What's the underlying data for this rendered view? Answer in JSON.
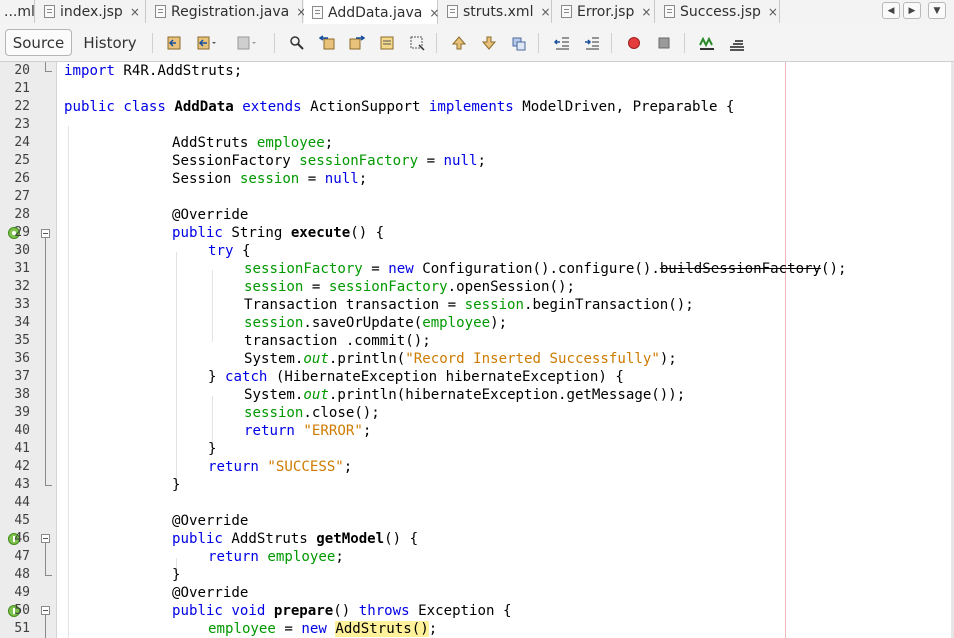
{
  "tabs": [
    {
      "label": "...ml",
      "icon": "file-icon",
      "active": false,
      "closable": false
    },
    {
      "label": "index.jsp",
      "icon": "jsp-file-icon",
      "active": false,
      "closable": true
    },
    {
      "label": "Registration.java",
      "icon": "java-file-icon",
      "active": false,
      "closable": true
    },
    {
      "label": "AddData.java",
      "icon": "java-file-icon",
      "active": true,
      "closable": true
    },
    {
      "label": "struts.xml",
      "icon": "xml-file-icon",
      "active": false,
      "closable": true
    },
    {
      "label": "Error.jsp",
      "icon": "jsp-file-icon",
      "active": false,
      "closable": true
    },
    {
      "label": "Success.jsp",
      "icon": "jsp-file-icon",
      "active": false,
      "closable": true
    }
  ],
  "tab_close_glyph": "×",
  "nav": {
    "left": "◀",
    "right": "▶",
    "dropdown": "▼"
  },
  "toolbar": {
    "source_label": "Source",
    "history_label": "History"
  },
  "editor": {
    "margin_color": "#f2b8b8",
    "lines": [
      {
        "n": "20",
        "segs": [
          {
            "t": "import",
            "c": "kw"
          },
          {
            "t": " R4R.AddStruts;"
          }
        ]
      },
      {
        "n": "21",
        "segs": []
      },
      {
        "n": "22",
        "segs": [
          {
            "t": "public class",
            "c": "kw"
          },
          {
            "t": " "
          },
          {
            "t": "AddData",
            "c": "bold"
          },
          {
            "t": " "
          },
          {
            "t": "extends",
            "c": "kw"
          },
          {
            "t": " ActionSupport "
          },
          {
            "t": "implements",
            "c": "kw"
          },
          {
            "t": " ModelDriven, Preparable {"
          }
        ]
      },
      {
        "n": "23",
        "segs": []
      },
      {
        "n": "24",
        "segs": [
          {
            "t": "AddStruts "
          },
          {
            "t": "employee",
            "c": "fld"
          },
          {
            "t": ";"
          }
        ]
      },
      {
        "n": "25",
        "segs": [
          {
            "t": "SessionFactory "
          },
          {
            "t": "sessionFactory",
            "c": "fld"
          },
          {
            "t": " = "
          },
          {
            "t": "null",
            "c": "kw"
          },
          {
            "t": ";"
          }
        ]
      },
      {
        "n": "26",
        "segs": [
          {
            "t": "Session "
          },
          {
            "t": "session",
            "c": "fld"
          },
          {
            "t": " = "
          },
          {
            "t": "null",
            "c": "kw"
          },
          {
            "t": ";"
          }
        ]
      },
      {
        "n": "27",
        "segs": []
      },
      {
        "n": "28",
        "segs": [
          {
            "t": "@Override"
          }
        ]
      },
      {
        "n": "29",
        "segs": [
          {
            "t": "public",
            "c": "kw"
          },
          {
            "t": " String "
          },
          {
            "t": "execute",
            "c": "bold"
          },
          {
            "t": "() {"
          }
        ]
      },
      {
        "n": "30",
        "segs": [
          {
            "t": "try",
            "c": "kw"
          },
          {
            "t": " {"
          }
        ]
      },
      {
        "n": "31",
        "segs": [
          {
            "t": "sessionFactory",
            "c": "fld"
          },
          {
            "t": " = "
          },
          {
            "t": "new",
            "c": "kw"
          },
          {
            "t": " Configuration().configure()."
          },
          {
            "t": "buildSessionFactory",
            "c": "strike"
          },
          {
            "t": "();"
          }
        ]
      },
      {
        "n": "32",
        "segs": [
          {
            "t": "session",
            "c": "fld"
          },
          {
            "t": " = "
          },
          {
            "t": "sessionFactory",
            "c": "fld"
          },
          {
            "t": ".openSession();"
          }
        ]
      },
      {
        "n": "33",
        "segs": [
          {
            "t": "Transaction transaction = "
          },
          {
            "t": "session",
            "c": "fld"
          },
          {
            "t": ".beginTransaction();"
          }
        ]
      },
      {
        "n": "34",
        "segs": [
          {
            "t": "session",
            "c": "fld"
          },
          {
            "t": ".saveOrUpdate("
          },
          {
            "t": "employee",
            "c": "fld"
          },
          {
            "t": ");"
          }
        ]
      },
      {
        "n": "35",
        "segs": [
          {
            "t": "transaction .commit();"
          }
        ]
      },
      {
        "n": "36",
        "segs": [
          {
            "t": "System."
          },
          {
            "t": "out",
            "c": "fld ital"
          },
          {
            "t": ".println("
          },
          {
            "t": "\"Record Inserted Successfully\"",
            "c": "str"
          },
          {
            "t": ");"
          }
        ]
      },
      {
        "n": "37",
        "segs": [
          {
            "t": "} "
          },
          {
            "t": "catch",
            "c": "kw"
          },
          {
            "t": " (HibernateException hibernateException) {"
          }
        ]
      },
      {
        "n": "38",
        "segs": [
          {
            "t": "System."
          },
          {
            "t": "out",
            "c": "fld ital"
          },
          {
            "t": ".println(hibernateException.getMessage());"
          }
        ]
      },
      {
        "n": "39",
        "segs": [
          {
            "t": "session",
            "c": "fld"
          },
          {
            "t": ".close();"
          }
        ]
      },
      {
        "n": "40",
        "segs": [
          {
            "t": "return",
            "c": "kw"
          },
          {
            "t": " "
          },
          {
            "t": "\"ERROR\"",
            "c": "str"
          },
          {
            "t": ";"
          }
        ]
      },
      {
        "n": "41",
        "segs": [
          {
            "t": "}"
          }
        ]
      },
      {
        "n": "42",
        "segs": [
          {
            "t": "return",
            "c": "kw"
          },
          {
            "t": " "
          },
          {
            "t": "\"SUCCESS\"",
            "c": "str"
          },
          {
            "t": ";"
          }
        ]
      },
      {
        "n": "43",
        "segs": [
          {
            "t": "}"
          }
        ]
      },
      {
        "n": "44",
        "segs": []
      },
      {
        "n": "45",
        "segs": [
          {
            "t": "@Override"
          }
        ]
      },
      {
        "n": "46",
        "segs": [
          {
            "t": "public",
            "c": "kw"
          },
          {
            "t": " AddStruts "
          },
          {
            "t": "getModel",
            "c": "bold"
          },
          {
            "t": "() {"
          }
        ]
      },
      {
        "n": "47",
        "segs": [
          {
            "t": "return",
            "c": "kw"
          },
          {
            "t": " "
          },
          {
            "t": "employee",
            "c": "fld"
          },
          {
            "t": ";"
          }
        ]
      },
      {
        "n": "48",
        "segs": [
          {
            "t": "}"
          }
        ]
      },
      {
        "n": "49",
        "segs": [
          {
            "t": "@Override"
          }
        ]
      },
      {
        "n": "50",
        "segs": [
          {
            "t": "public void",
            "c": "kw"
          },
          {
            "t": " "
          },
          {
            "t": "prepare",
            "c": "bold"
          },
          {
            "t": "() "
          },
          {
            "t": "throws",
            "c": "kw"
          },
          {
            "t": " Exception {"
          }
        ]
      },
      {
        "n": "51",
        "segs": [
          {
            "t": "employee",
            "c": "fld"
          },
          {
            "t": " = "
          },
          {
            "t": "new",
            "c": "kw"
          },
          {
            "t": " "
          },
          {
            "t": "AddStruts",
            "c": "hl"
          },
          {
            "t": "()",
            "c": "hl"
          },
          {
            "t": ";"
          }
        ]
      }
    ]
  }
}
